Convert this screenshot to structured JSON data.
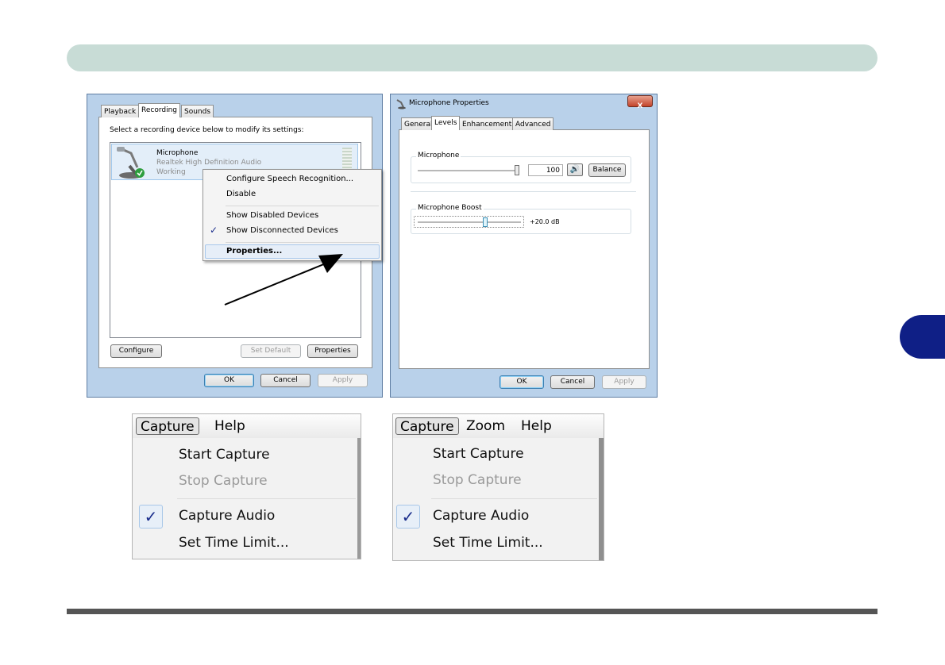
{
  "sound_dialog": {
    "tabs": [
      "Playback",
      "Recording",
      "Sounds"
    ],
    "instruction": "Select a recording device below to modify its settings:",
    "device": {
      "name": "Microphone",
      "driver": "Realtek High Definition Audio",
      "status": "Working"
    },
    "context_menu": {
      "items": [
        "Configure Speech Recognition...",
        "Disable",
        "Show Disabled Devices",
        "Show Disconnected Devices",
        "Properties..."
      ]
    },
    "buttons": {
      "configure": "Configure",
      "set_default": "Set Default",
      "properties": "Properties"
    },
    "footer": {
      "ok": "OK",
      "cancel": "Cancel",
      "apply": "Apply"
    }
  },
  "mic_properties": {
    "title": "Microphone Properties",
    "close_label": "X",
    "tabs": [
      "General",
      "Levels",
      "Enhancements",
      "Advanced"
    ],
    "microphone_group": "Microphone",
    "microphone_level": "100",
    "microphone_level_value": 100,
    "balance_label": "Balance",
    "boost_group": "Microphone Boost",
    "boost_value": "+20.0 dB",
    "footer": {
      "ok": "OK",
      "cancel": "Cancel",
      "apply": "Apply"
    }
  },
  "capture_menu_a": {
    "menubar": [
      "Capture",
      "Help"
    ],
    "items": [
      "Start Capture",
      "Stop Capture",
      "Capture Audio",
      "Set Time Limit..."
    ]
  },
  "capture_menu_b": {
    "menubar": [
      "Capture",
      "Zoom",
      "Help"
    ],
    "items": [
      "Start Capture",
      "Stop Capture",
      "Capture Audio",
      "Set Time Limit..."
    ]
  },
  "colors": {
    "header": "#c8dcd6",
    "side_tab": "#0f1f86",
    "check": "#1b2e8c"
  },
  "icons": [
    "microphone-icon",
    "check-icon",
    "speaker-icon",
    "close-icon",
    "arrow-icon"
  ]
}
